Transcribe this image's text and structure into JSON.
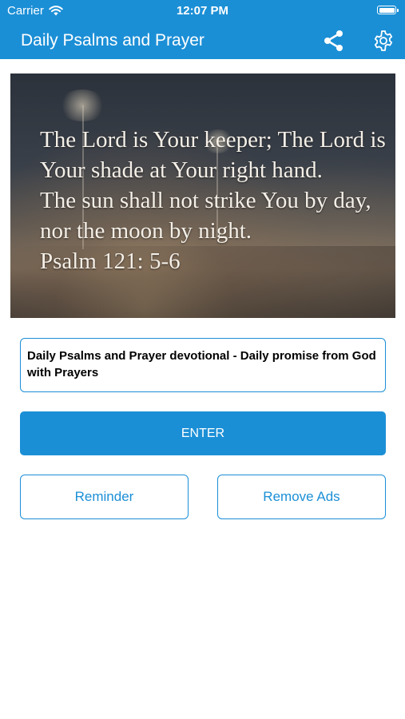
{
  "status_bar": {
    "carrier": "Carrier",
    "time": "12:07 PM"
  },
  "header": {
    "title": "Daily Psalms and Prayer",
    "share_icon": "share-icon",
    "settings_icon": "gear-icon",
    "background_color": "#1b8fd6"
  },
  "hero": {
    "verse_lines": [
      "The Lord is Your keeper; The Lord is",
      "Your shade at Your right hand.",
      "The sun shall not strike You by day,",
      "nor the moon by night.",
      "Psalm 121: 5-6"
    ]
  },
  "description": {
    "text": "Daily Psalms and Prayer devotional - Daily promise from God with Prayers"
  },
  "buttons": {
    "enter": "ENTER",
    "reminder": "Reminder",
    "remove_ads": "Remove Ads"
  },
  "colors": {
    "accent": "#1b8fd6",
    "background": "#ffffff"
  }
}
